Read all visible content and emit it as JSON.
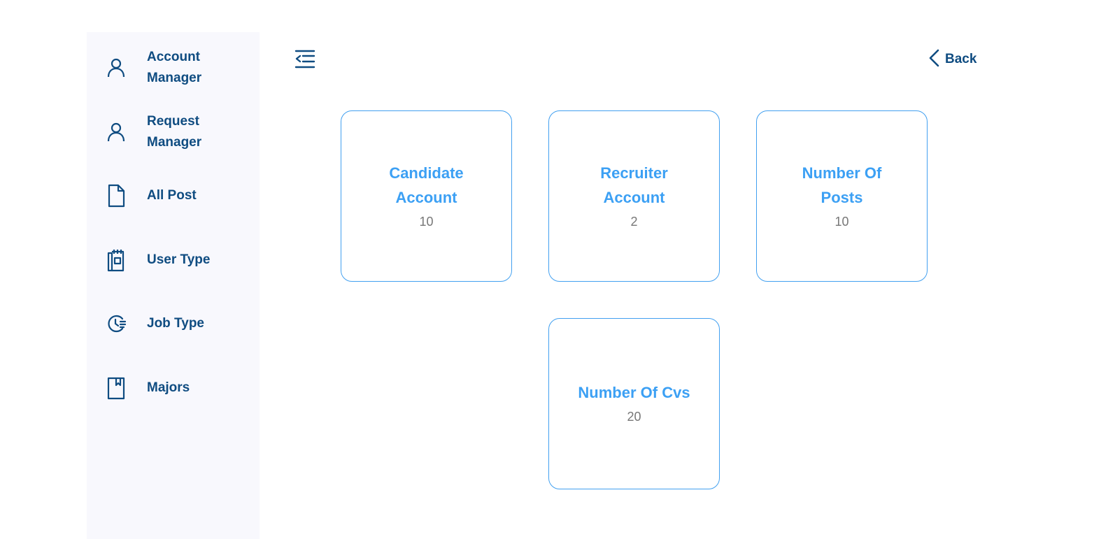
{
  "sidebar": {
    "items": [
      {
        "label": "Account Manager",
        "icon": "user-icon"
      },
      {
        "label": "Request Manager",
        "icon": "user-icon"
      },
      {
        "label": "All Post",
        "icon": "document-icon"
      },
      {
        "label": "User Type",
        "icon": "clipboard-icon"
      },
      {
        "label": "Job Type",
        "icon": "clock-icon"
      },
      {
        "label": "Majors",
        "icon": "bookmark-icon"
      }
    ]
  },
  "header": {
    "menu_icon": "indent-menu-icon",
    "back_label": "Back"
  },
  "stats": [
    {
      "title": "Candidate Account",
      "value": "10"
    },
    {
      "title": "Recruiter Account",
      "value": "2"
    },
    {
      "title": "Number Of Posts",
      "value": "10"
    },
    {
      "title": "Number Of Cvs",
      "value": "20"
    }
  ],
  "colors": {
    "sidebar_bg": "#f8f8fd",
    "nav_text": "#0f4c81",
    "card_border": "#42a0f0",
    "card_title": "#3ca0f4",
    "card_value": "#777777"
  }
}
